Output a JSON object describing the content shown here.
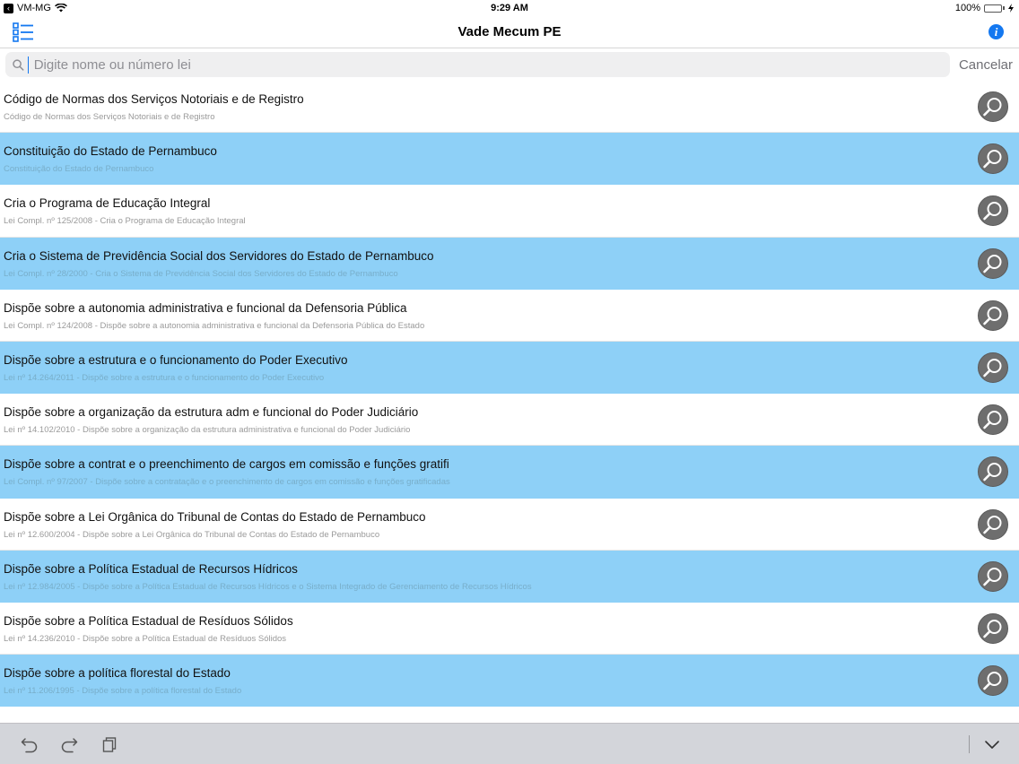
{
  "status_bar": {
    "carrier": "VM-MG",
    "time": "9:29 AM",
    "battery": "100%",
    "battery_level": 1.0
  },
  "nav": {
    "title": "Vade Mecum PE"
  },
  "search": {
    "placeholder": "Digite nome ou número lei",
    "value": "",
    "cancel_label": "Cancelar"
  },
  "laws": [
    {
      "title": "Código de Normas dos Serviços Notoriais e de Registro",
      "subtitle": "Código de Normas dos Serviços Notoriais e de Registro"
    },
    {
      "title": "Constituição do Estado de Pernambuco",
      "subtitle": "Constituição do Estado de Pernambuco"
    },
    {
      "title": "Cria o Programa de Educação Integral",
      "subtitle": "Lei Compl. nº 125/2008 - Cria o Programa de Educação Integral"
    },
    {
      "title": "Cria o Sistema de Previdência Social dos Servidores do Estado de Pernambuco",
      "subtitle": "Lei Compl. nº 28/2000 - Cria o Sistema de Previdência Social dos Servidores do Estado de Pernambuco"
    },
    {
      "title": "Dispõe  sobre a autonomia administrativa e funcional da Defensoria Pública",
      "subtitle": "Lei Compl. nº 124/2008 - Dispõe  sobre a autonomia administrativa e funcional da Defensoria Pública do Estado"
    },
    {
      "title": "Dispõe  sobre a estrutura e o funcionamento do Poder Executivo",
      "subtitle": "Lei nº 14.264/2011 - Dispõe  sobre a estrutura e o funcionamento do Poder Executivo"
    },
    {
      "title": "Dispõe  sobre a organização da estrutura adm e funcional do Poder Judiciário",
      "subtitle": "Lei nº 14.102/2010 - Dispõe  sobre a organização da estrutura administrativa e funcional do Poder Judiciário"
    },
    {
      "title": "Dispõe sobre a contrat e o preenchimento de cargos em comissão e funções gratifi",
      "subtitle": "Lei Compl. nº 97/2007 - Dispõe sobre a contratação e o preenchimento de cargos em comissão e funções gratificadas"
    },
    {
      "title": "Dispõe sobre a Lei Orgânica do Tribunal de Contas do Estado de Pernambuco",
      "subtitle": "Lei nº 12.600/2004 - Dispõe sobre a Lei Orgânica do Tribunal de Contas do Estado de Pernambuco"
    },
    {
      "title": "Dispõe sobre a Política Estadual de Recursos Hídricos",
      "subtitle": "Lei nº 12.984/2005 - Dispõe sobre a Política Estadual de Recursos Hídricos e o Sistema Integrado de Gerenciamento de Recursos Hídricos"
    },
    {
      "title": "Dispõe sobre a Política Estadual de Resíduos Sólidos",
      "subtitle": "Lei nº 14.236/2010 - Dispõe sobre a Política Estadual de Resíduos Sólidos"
    },
    {
      "title": "Dispõe sobre a política florestal do Estado",
      "subtitle": "Lei nº 11.206/1995 - Dispõe sobre a política florestal do Estado"
    }
  ],
  "icons": {
    "menu": "list-menu-icon",
    "info": "info-icon",
    "search": "magnifier-icon",
    "undo": "undo-icon",
    "redo": "redo-icon",
    "paste": "clipboard-icon",
    "dismiss": "chevron-down-icon"
  },
  "colors": {
    "accent": "#1478f0",
    "alt_row": "#8ed0f7",
    "row_button": "#6e6e6e",
    "toolbar": "#d3d5da"
  }
}
